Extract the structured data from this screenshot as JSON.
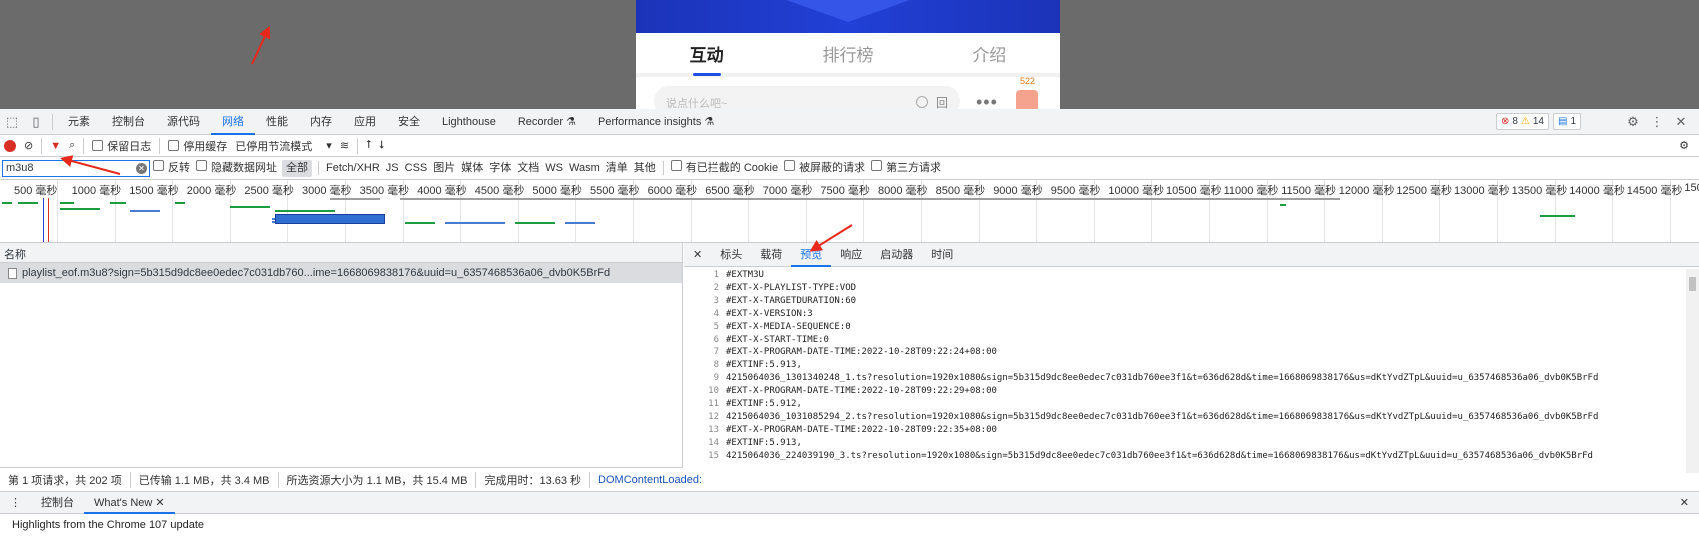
{
  "phone": {
    "tabs": [
      "互动",
      "排行榜",
      "介绍"
    ],
    "input_placeholder": "说点什么吧~",
    "input_button": "回",
    "like_count": "522"
  },
  "devtools": {
    "top_tabs": [
      "元素",
      "控制台",
      "源代码",
      "网络",
      "性能",
      "内存",
      "应用",
      "安全",
      "Lighthouse",
      "Recorder ⚗",
      "Performance insights ⚗"
    ],
    "selected_tab": "网络",
    "errors": "8",
    "warnings": "14",
    "messages": "1",
    "toolbar": {
      "preserve_log": "保留日志",
      "disable_cache": "停用缓存",
      "throttle": "已停用节流模式"
    },
    "filter": {
      "value": "m3u8",
      "invert": "反转",
      "hide_data_urls": "隐藏数据网址",
      "types": [
        "全部",
        "Fetch/XHR",
        "JS",
        "CSS",
        "图片",
        "媒体",
        "字体",
        "文档",
        "WS",
        "Wasm",
        "清单",
        "其他"
      ],
      "blocked_cookies": "有已拦截的 Cookie",
      "blocked_requests": "被屏蔽的请求",
      "third_party": "第三方请求"
    },
    "timeline_ticks": [
      "500 毫秒",
      "1000 毫秒",
      "1500 毫秒",
      "2000 毫秒",
      "2500 毫秒",
      "3000 毫秒",
      "3500 毫秒",
      "4000 毫秒",
      "4500 毫秒",
      "5000 毫秒",
      "5500 毫秒",
      "6000 毫秒",
      "6500 毫秒",
      "7000 毫秒",
      "7500 毫秒",
      "8000 毫秒",
      "8500 毫秒",
      "9000 毫秒",
      "9500 毫秒",
      "10000 毫秒",
      "10500 毫秒",
      "11000 毫秒",
      "11500 毫秒",
      "12000 毫秒",
      "12500 毫秒",
      "13000 毫秒",
      "13500 毫秒",
      "14000 毫秒",
      "14500 毫秒",
      "150"
    ],
    "request_list": {
      "header": "名称",
      "rows": [
        "playlist_eof.m3u8?sign=5b315d9dc8ee0edec7c031db760...ime=1668069838176&uuid=u_6357468536a06_dvb0K5BrFd"
      ]
    },
    "detail_tabs": [
      "标头",
      "载荷",
      "预览",
      "响应",
      "启动器",
      "时间"
    ],
    "detail_selected": "预览",
    "preview_lines": [
      "#EXTM3U",
      "#EXT-X-PLAYLIST-TYPE:VOD",
      "#EXT-X-TARGETDURATION:60",
      "#EXT-X-VERSION:3",
      "#EXT-X-MEDIA-SEQUENCE:0",
      "#EXT-X-START-TIME:0",
      "#EXT-X-PROGRAM-DATE-TIME:2022-10-28T09:22:24+08:00",
      "#EXTINF:5.913,",
      "4215064036_1301340248_1.ts?resolution=1920x1080&sign=5b315d9dc8ee0edec7c031db760ee3f1&t=636d628d&time=1668069838176&us=dKtYvdZTpL&uuid=u_6357468536a06_dvb0K5BrFd",
      "#EXT-X-PROGRAM-DATE-TIME:2022-10-28T09:22:29+08:00",
      "#EXTINF:5.912,",
      "4215064036_1031085294_2.ts?resolution=1920x1080&sign=5b315d9dc8ee0edec7c031db760ee3f1&t=636d628d&time=1668069838176&us=dKtYvdZTpL&uuid=u_6357468536a06_dvb0K5BrFd",
      "#EXT-X-PROGRAM-DATE-TIME:2022-10-28T09:22:35+08:00",
      "#EXTINF:5.913,",
      "4215064036_224039190_3.ts?resolution=1920x1080&sign=5b315d9dc8ee0edec7c031db760ee3f1&t=636d628d&time=1668069838176&us=dKtYvdZTpL&uuid=u_6357468536a06_dvb0K5BrFd"
    ],
    "status": {
      "requests": "第 1 项请求，共 202 项",
      "transferred": "已传输 1.1 MB，共 3.4 MB",
      "resources": "所选资源大小为 1.1 MB，共 15.4 MB",
      "finish": "完成用时：13.63 秒",
      "dcl": "DOMContentLoaded:"
    },
    "drawer": {
      "tabs": [
        "控制台",
        "What's New"
      ],
      "content": "Highlights from the Chrome 107 update"
    }
  }
}
